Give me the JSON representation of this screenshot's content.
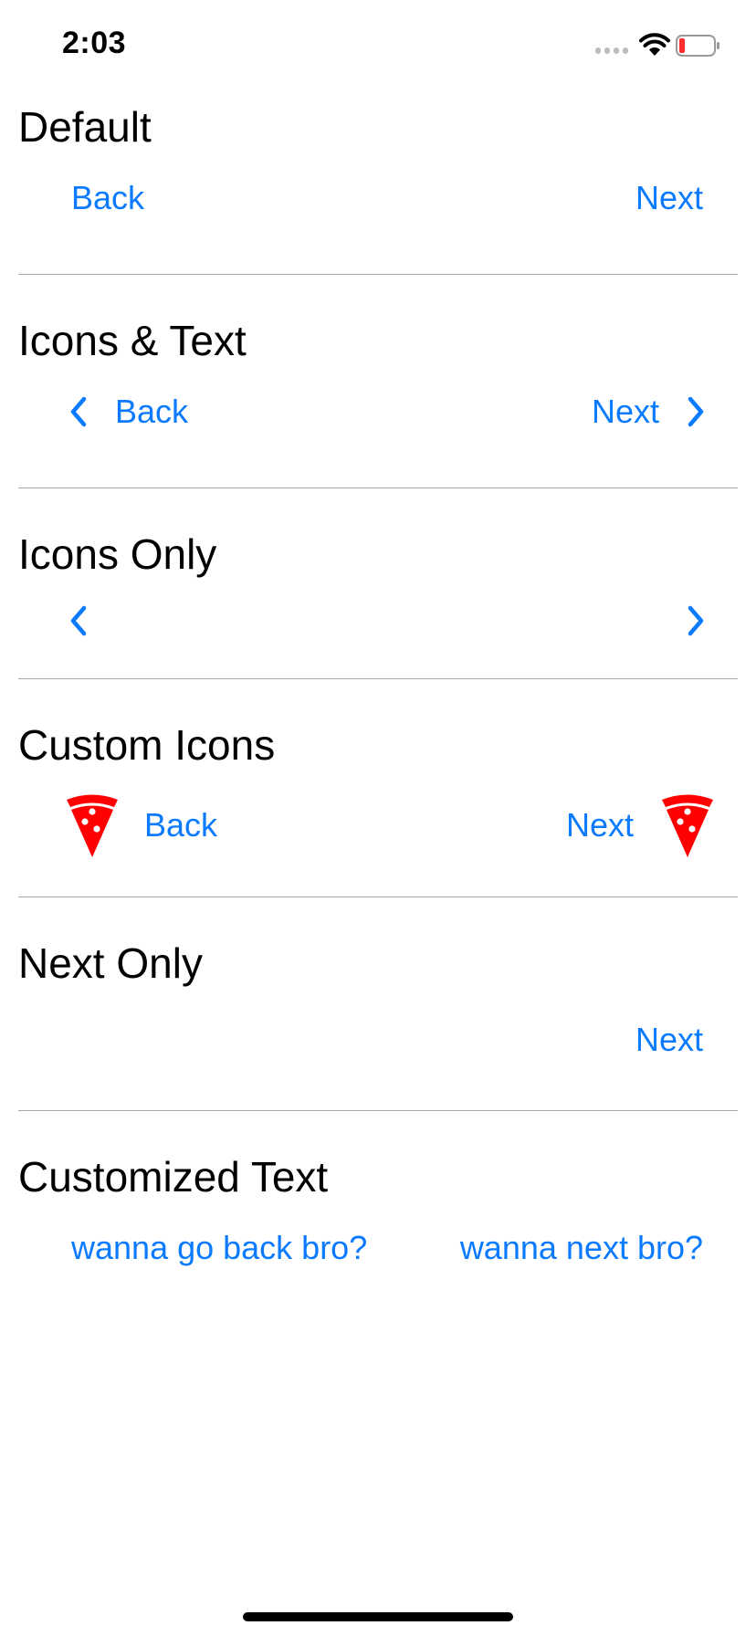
{
  "status_bar": {
    "time": "2:03"
  },
  "sections": {
    "default": {
      "title": "Default",
      "back_label": "Back",
      "next_label": "Next"
    },
    "icons_text": {
      "title": "Icons & Text",
      "back_label": "Back",
      "next_label": "Next"
    },
    "icons_only": {
      "title": "Icons Only"
    },
    "custom_icons": {
      "title": "Custom Icons",
      "back_label": "Back",
      "next_label": "Next",
      "icon": "pizza-slice-icon"
    },
    "next_only": {
      "title": "Next Only",
      "next_label": "Next"
    },
    "customized_text": {
      "title": "Customized Text",
      "back_label": "wanna go back bro?",
      "next_label": "wanna next bro?"
    }
  },
  "colors": {
    "accent": "#0a7aff",
    "pizza": "#ff0000",
    "divider": "#a8a8a8"
  }
}
